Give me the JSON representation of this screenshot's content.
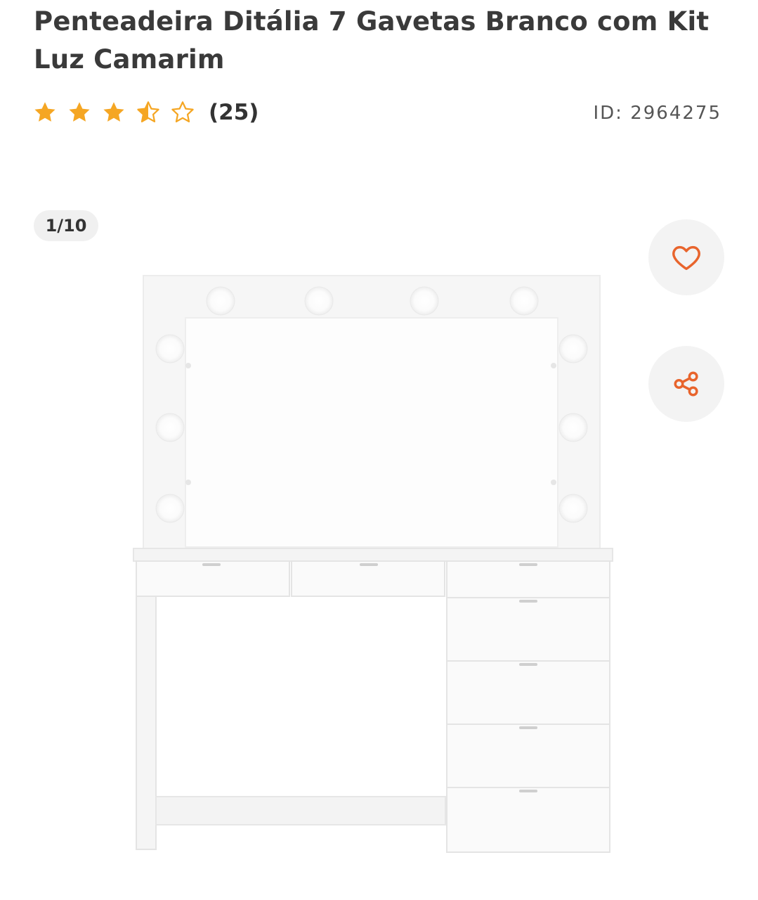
{
  "product": {
    "title": "Penteadeira Ditália 7 Gavetas Branco com Kit Luz Camarim",
    "rating_value": 3.5,
    "rating_max": 5,
    "review_count": "(25)",
    "id_text": "ID: 2964275"
  },
  "gallery": {
    "counter": "1/10",
    "image_subject": "white vanity dresser with lighted mirror and 7 drawers"
  },
  "actions": {
    "favorite_icon": "heart-icon",
    "share_icon": "share-icon"
  },
  "colors": {
    "star": "#f5a623",
    "accent": "#e8642c",
    "text": "#3a3a3a",
    "button_bg": "#f3f3f3"
  }
}
